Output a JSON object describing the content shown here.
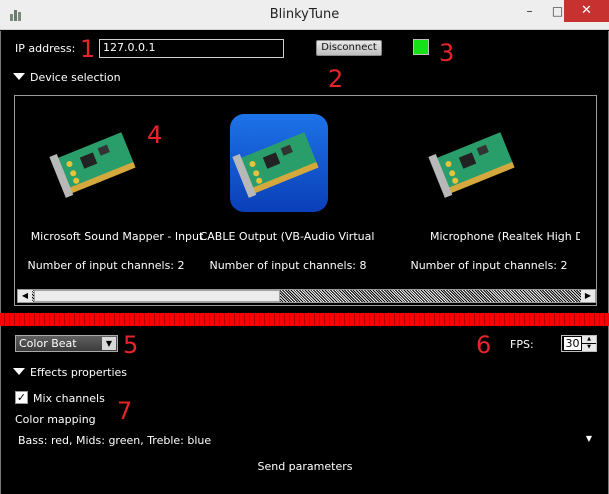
{
  "window": {
    "title": "BlinkyTune",
    "minimize_glyph": "–",
    "maximize_glyph": "□",
    "close_glyph": "✕"
  },
  "connection": {
    "ip_label": "IP address:",
    "ip_value": "127.0.0.1",
    "disconnect_label": "Disconnect",
    "status_color": "#16e016"
  },
  "device_selection": {
    "header": "Device selection",
    "devices": [
      {
        "name": "Microsoft Sound Mapper - Input",
        "channels": "Number of input channels: 2",
        "selected": false
      },
      {
        "name": "CABLE Output (VB-Audio Virtual",
        "channels": "Number of input channels: 8",
        "selected": true
      },
      {
        "name": "Microphone (Realtek High Defini",
        "channels": "Number of input channels: 2",
        "selected": false
      }
    ]
  },
  "effect": {
    "selected": "Color Beat",
    "fps_label": "FPS:",
    "fps_value": "30"
  },
  "effects_properties": {
    "header": "Effects properties",
    "mix_channels_label": "Mix channels",
    "mix_channels_checked": true,
    "color_mapping_label": "Color mapping",
    "color_mapping_value": "Bass: red, Mids: green, Treble: blue",
    "send_label": "Send parameters"
  },
  "annotations": [
    "1",
    "2",
    "3",
    "4",
    "5",
    "6",
    "7"
  ],
  "colors": {
    "annotation": "#e5252a",
    "vu_meter": "#ff0000",
    "selection": "#1e73e8",
    "close_button": "#c7312f"
  },
  "icons": [
    "sound-card-icon",
    "app-icon",
    "dropdown-arrow-icon",
    "expand-triangle-icon"
  ]
}
